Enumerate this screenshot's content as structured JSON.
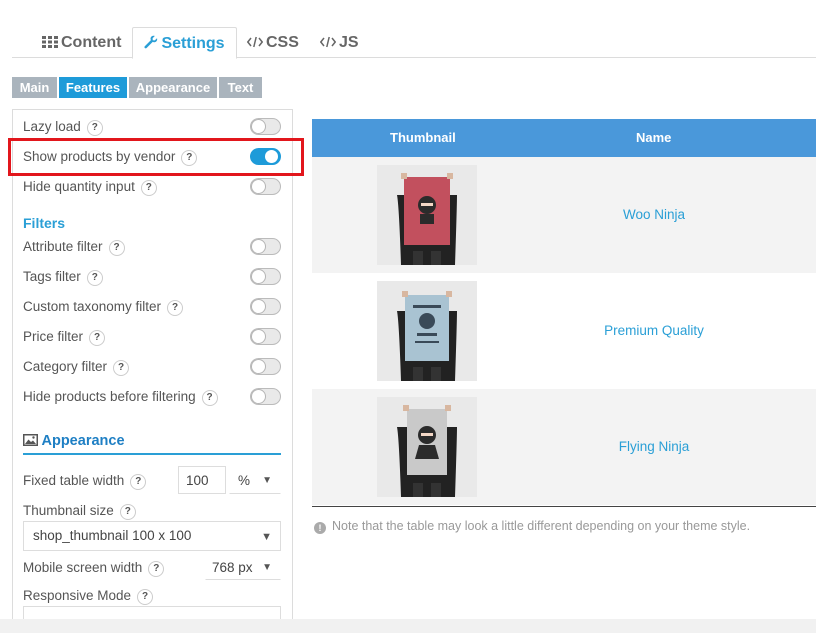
{
  "top_tabs": [
    {
      "label": "Content",
      "icon": "grid-icon"
    },
    {
      "label": "Settings",
      "icon": "wrench-icon",
      "active": true
    },
    {
      "label": "CSS",
      "icon": "code-icon"
    },
    {
      "label": "JS",
      "icon": "code-icon"
    }
  ],
  "sub_tabs": [
    {
      "label": "Main"
    },
    {
      "label": "Features",
      "active": true
    },
    {
      "label": "Appearance"
    },
    {
      "label": "Text"
    }
  ],
  "help_glyph": "?",
  "options": [
    {
      "label": "Lazy load",
      "on": false
    },
    {
      "label": "Show products by vendor",
      "on": true
    },
    {
      "label": "Hide quantity input",
      "on": false
    }
  ],
  "filters": {
    "heading": "Filters",
    "items": [
      {
        "label": "Attribute filter",
        "on": false
      },
      {
        "label": "Tags filter",
        "on": false
      },
      {
        "label": "Custom taxonomy filter",
        "on": false
      },
      {
        "label": "Price filter",
        "on": false
      },
      {
        "label": "Category filter",
        "on": false
      },
      {
        "label": "Hide products before filtering",
        "on": false
      }
    ]
  },
  "appearance": {
    "heading": "Appearance",
    "fixed_width_label": "Fixed table width",
    "fixed_width_value": "100",
    "fixed_width_unit": "%",
    "thumbnail_size_label": "Thumbnail size",
    "thumbnail_size_value": "shop_thumbnail 100 x 100",
    "mobile_width_label": "Mobile screen width",
    "mobile_width_value": "768 px",
    "responsive_mode_label": "Responsive Mode"
  },
  "table": {
    "headers": {
      "thumbnail": "Thumbnail",
      "name": "Name"
    },
    "rows": [
      {
        "name": "Woo Ninja",
        "poster_color": "#c2505e"
      },
      {
        "name": "Premium Quality",
        "poster_color": "#a9c3d2"
      },
      {
        "name": "Flying Ninja",
        "poster_color": "#c9c9c9"
      }
    ]
  },
  "note": "Note that the table may look a little different depending on your theme style.",
  "colors": {
    "accent": "#1e9bd9",
    "header_bg": "#4a98da",
    "highlight": "#e2161c"
  }
}
